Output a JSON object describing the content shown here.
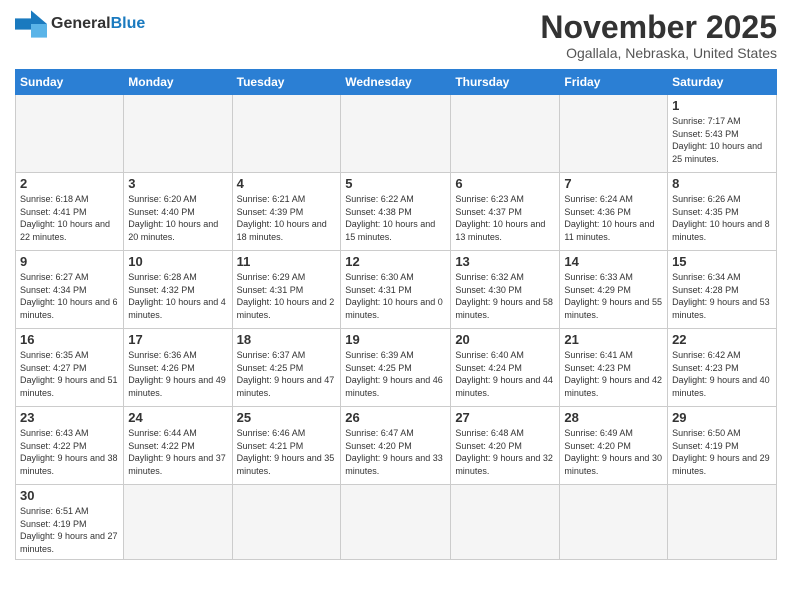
{
  "header": {
    "logo_general": "General",
    "logo_blue": "Blue",
    "month_title": "November 2025",
    "location": "Ogallala, Nebraska, United States"
  },
  "weekdays": [
    "Sunday",
    "Monday",
    "Tuesday",
    "Wednesday",
    "Thursday",
    "Friday",
    "Saturday"
  ],
  "weeks": [
    [
      {
        "day": "",
        "info": ""
      },
      {
        "day": "",
        "info": ""
      },
      {
        "day": "",
        "info": ""
      },
      {
        "day": "",
        "info": ""
      },
      {
        "day": "",
        "info": ""
      },
      {
        "day": "",
        "info": ""
      },
      {
        "day": "1",
        "info": "Sunrise: 7:17 AM\nSunset: 5:43 PM\nDaylight: 10 hours and 25 minutes."
      }
    ],
    [
      {
        "day": "2",
        "info": "Sunrise: 6:18 AM\nSunset: 4:41 PM\nDaylight: 10 hours and 22 minutes."
      },
      {
        "day": "3",
        "info": "Sunrise: 6:20 AM\nSunset: 4:40 PM\nDaylight: 10 hours and 20 minutes."
      },
      {
        "day": "4",
        "info": "Sunrise: 6:21 AM\nSunset: 4:39 PM\nDaylight: 10 hours and 18 minutes."
      },
      {
        "day": "5",
        "info": "Sunrise: 6:22 AM\nSunset: 4:38 PM\nDaylight: 10 hours and 15 minutes."
      },
      {
        "day": "6",
        "info": "Sunrise: 6:23 AM\nSunset: 4:37 PM\nDaylight: 10 hours and 13 minutes."
      },
      {
        "day": "7",
        "info": "Sunrise: 6:24 AM\nSunset: 4:36 PM\nDaylight: 10 hours and 11 minutes."
      },
      {
        "day": "8",
        "info": "Sunrise: 6:26 AM\nSunset: 4:35 PM\nDaylight: 10 hours and 8 minutes."
      }
    ],
    [
      {
        "day": "9",
        "info": "Sunrise: 6:27 AM\nSunset: 4:34 PM\nDaylight: 10 hours and 6 minutes."
      },
      {
        "day": "10",
        "info": "Sunrise: 6:28 AM\nSunset: 4:32 PM\nDaylight: 10 hours and 4 minutes."
      },
      {
        "day": "11",
        "info": "Sunrise: 6:29 AM\nSunset: 4:31 PM\nDaylight: 10 hours and 2 minutes."
      },
      {
        "day": "12",
        "info": "Sunrise: 6:30 AM\nSunset: 4:31 PM\nDaylight: 10 hours and 0 minutes."
      },
      {
        "day": "13",
        "info": "Sunrise: 6:32 AM\nSunset: 4:30 PM\nDaylight: 9 hours and 58 minutes."
      },
      {
        "day": "14",
        "info": "Sunrise: 6:33 AM\nSunset: 4:29 PM\nDaylight: 9 hours and 55 minutes."
      },
      {
        "day": "15",
        "info": "Sunrise: 6:34 AM\nSunset: 4:28 PM\nDaylight: 9 hours and 53 minutes."
      }
    ],
    [
      {
        "day": "16",
        "info": "Sunrise: 6:35 AM\nSunset: 4:27 PM\nDaylight: 9 hours and 51 minutes."
      },
      {
        "day": "17",
        "info": "Sunrise: 6:36 AM\nSunset: 4:26 PM\nDaylight: 9 hours and 49 minutes."
      },
      {
        "day": "18",
        "info": "Sunrise: 6:37 AM\nSunset: 4:25 PM\nDaylight: 9 hours and 47 minutes."
      },
      {
        "day": "19",
        "info": "Sunrise: 6:39 AM\nSunset: 4:25 PM\nDaylight: 9 hours and 46 minutes."
      },
      {
        "day": "20",
        "info": "Sunrise: 6:40 AM\nSunset: 4:24 PM\nDaylight: 9 hours and 44 minutes."
      },
      {
        "day": "21",
        "info": "Sunrise: 6:41 AM\nSunset: 4:23 PM\nDaylight: 9 hours and 42 minutes."
      },
      {
        "day": "22",
        "info": "Sunrise: 6:42 AM\nSunset: 4:23 PM\nDaylight: 9 hours and 40 minutes."
      }
    ],
    [
      {
        "day": "23",
        "info": "Sunrise: 6:43 AM\nSunset: 4:22 PM\nDaylight: 9 hours and 38 minutes."
      },
      {
        "day": "24",
        "info": "Sunrise: 6:44 AM\nSunset: 4:22 PM\nDaylight: 9 hours and 37 minutes."
      },
      {
        "day": "25",
        "info": "Sunrise: 6:46 AM\nSunset: 4:21 PM\nDaylight: 9 hours and 35 minutes."
      },
      {
        "day": "26",
        "info": "Sunrise: 6:47 AM\nSunset: 4:20 PM\nDaylight: 9 hours and 33 minutes."
      },
      {
        "day": "27",
        "info": "Sunrise: 6:48 AM\nSunset: 4:20 PM\nDaylight: 9 hours and 32 minutes."
      },
      {
        "day": "28",
        "info": "Sunrise: 6:49 AM\nSunset: 4:20 PM\nDaylight: 9 hours and 30 minutes."
      },
      {
        "day": "29",
        "info": "Sunrise: 6:50 AM\nSunset: 4:19 PM\nDaylight: 9 hours and 29 minutes."
      }
    ],
    [
      {
        "day": "30",
        "info": "Sunrise: 6:51 AM\nSunset: 4:19 PM\nDaylight: 9 hours and 27 minutes."
      },
      {
        "day": "",
        "info": ""
      },
      {
        "day": "",
        "info": ""
      },
      {
        "day": "",
        "info": ""
      },
      {
        "day": "",
        "info": ""
      },
      {
        "day": "",
        "info": ""
      },
      {
        "day": "",
        "info": ""
      }
    ]
  ]
}
